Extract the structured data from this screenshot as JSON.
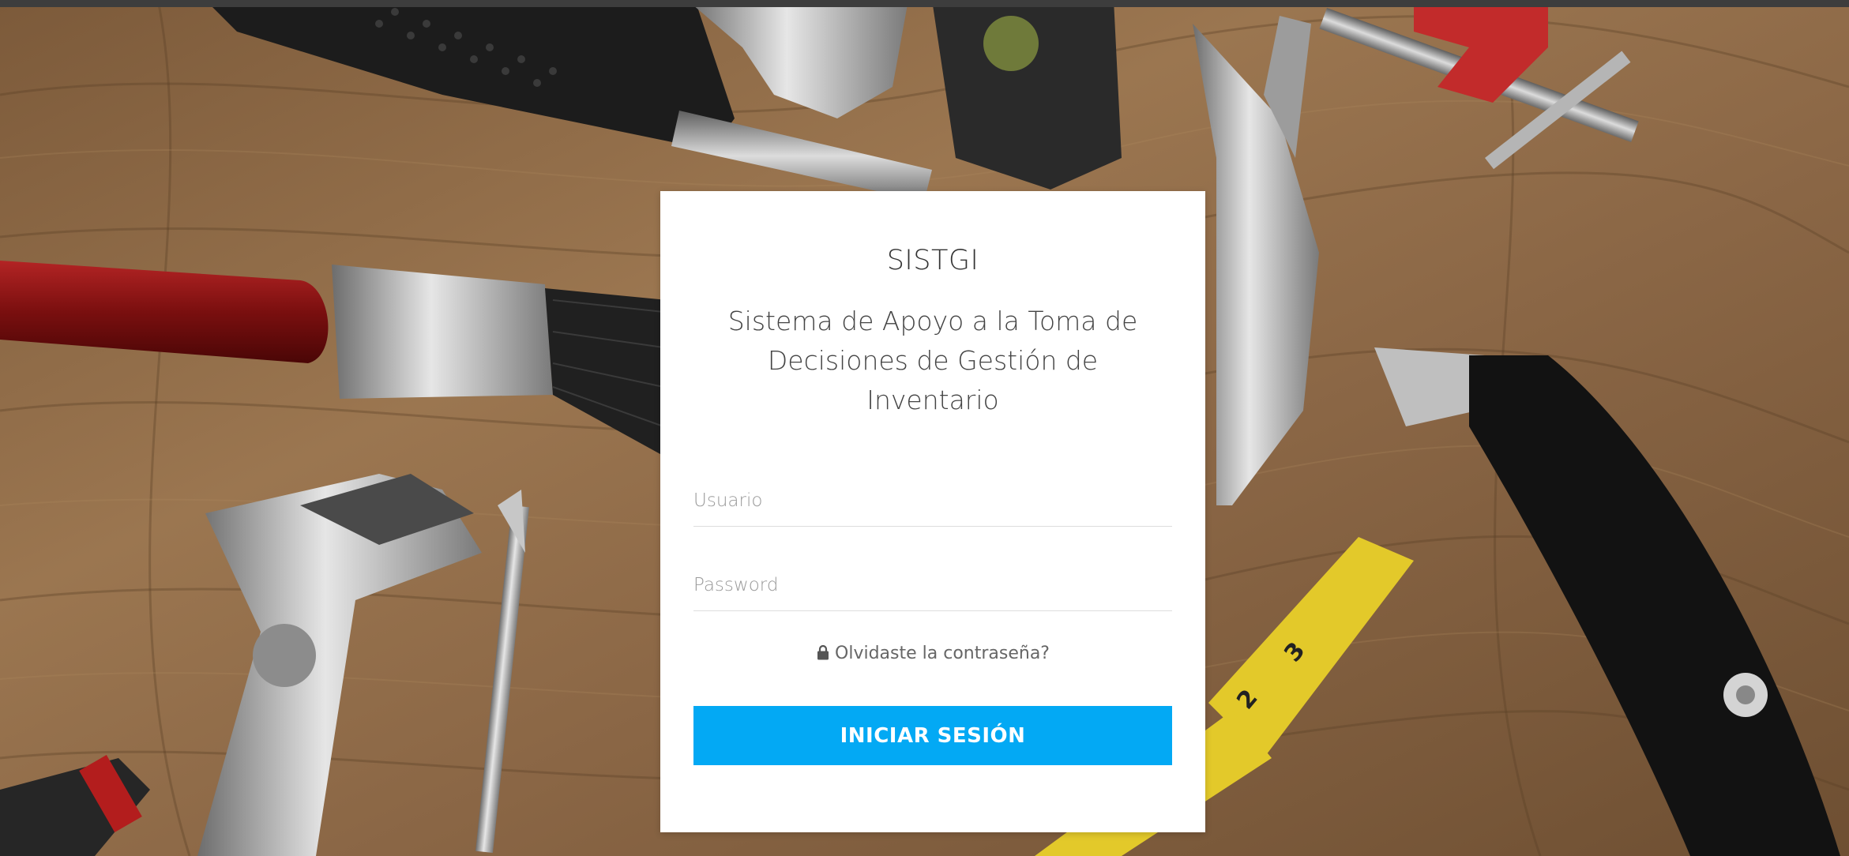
{
  "login": {
    "title": "SISTGI",
    "subtitle": "Sistema de Apoyo a la Toma de Decisiones de Gestión de Inventario",
    "username_placeholder": "Usuario",
    "password_placeholder": "Password",
    "forgot_label": "Olvidaste la contraseña?",
    "submit_label": "INICIAR SESIÓN"
  },
  "colors": {
    "accent": "#03a9f4",
    "background": "#8a6a48"
  },
  "icons": {
    "forgot": "lock-icon"
  }
}
